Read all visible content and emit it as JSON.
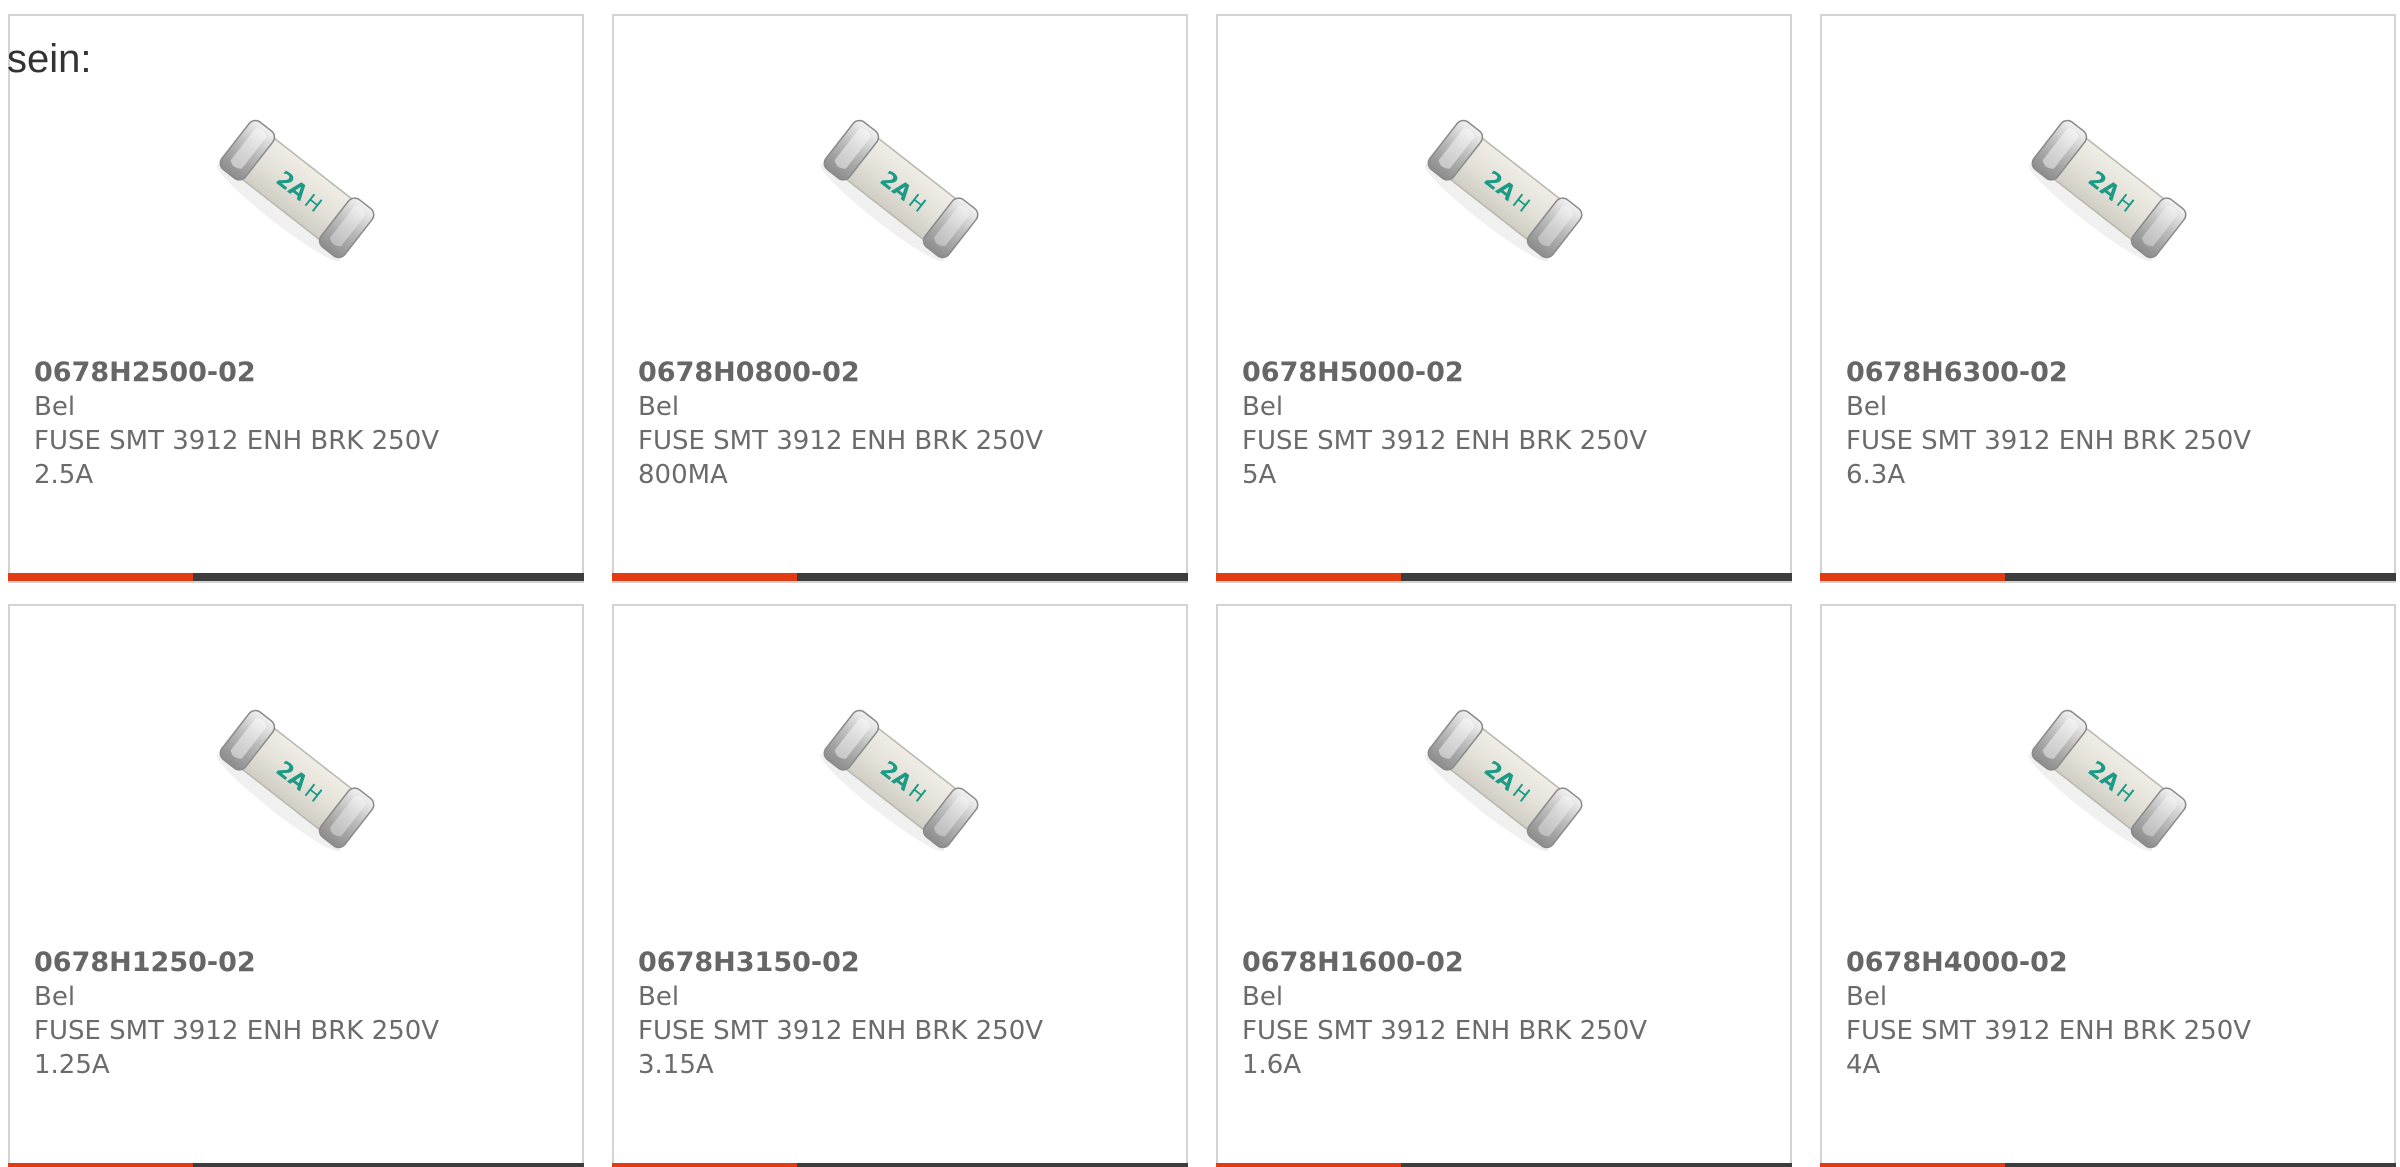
{
  "intro_text": "sein:",
  "colors": {
    "accent": "#e23b14",
    "bar": "#3d3d3d",
    "fuse_marking": "#1b9a86"
  },
  "products": [
    {
      "part_number": "0678H2500-02",
      "manufacturer": "Bel",
      "description": "FUSE SMT 3912 ENH BRK 250V",
      "rating": "2.5A",
      "image_icon": "smd-fuse-image"
    },
    {
      "part_number": "0678H0800-02",
      "manufacturer": "Bel",
      "description": "FUSE SMT 3912 ENH BRK 250V",
      "rating": "800MA",
      "image_icon": "smd-fuse-image"
    },
    {
      "part_number": "0678H5000-02",
      "manufacturer": "Bel",
      "description": "FUSE SMT 3912 ENH BRK 250V",
      "rating": "5A",
      "image_icon": "smd-fuse-image"
    },
    {
      "part_number": "0678H6300-02",
      "manufacturer": "Bel",
      "description": "FUSE SMT 3912 ENH BRK 250V",
      "rating": "6.3A",
      "image_icon": "smd-fuse-image"
    },
    {
      "part_number": "0678H1250-02",
      "manufacturer": "Bel",
      "description": "FUSE SMT 3912 ENH BRK 250V",
      "rating": "1.25A",
      "image_icon": "smd-fuse-image"
    },
    {
      "part_number": "0678H3150-02",
      "manufacturer": "Bel",
      "description": "FUSE SMT 3912 ENH BRK 250V",
      "rating": "3.15A",
      "image_icon": "smd-fuse-image"
    },
    {
      "part_number": "0678H1600-02",
      "manufacturer": "Bel",
      "description": "FUSE SMT 3912 ENH BRK 250V",
      "rating": "1.6A",
      "image_icon": "smd-fuse-image"
    },
    {
      "part_number": "0678H4000-02",
      "manufacturer": "Bel",
      "description": "FUSE SMT 3912 ENH BRK 250V",
      "rating": "4A",
      "image_icon": "smd-fuse-image"
    }
  ]
}
